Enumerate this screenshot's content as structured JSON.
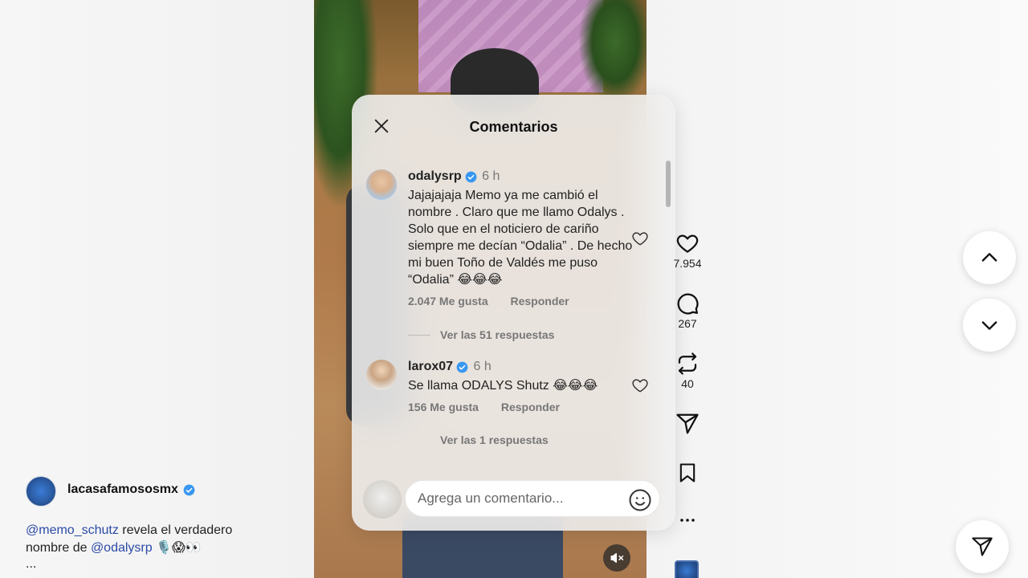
{
  "panel": {
    "title": "Comentarios"
  },
  "comments": [
    {
      "username": "odalysrp",
      "time": "6 h",
      "text": "Jajajajaja Memo ya me cambió el nombre . Claro que me llamo Odalys . Solo que en el noticiero de cariño siempre me decían “Odalia” . De hecho mi buen Toño de Valdés me puso “Odalia” 😂😂😂",
      "likes": "2.047 Me gusta",
      "reply": "Responder",
      "view_replies": "Ver las 51 respuestas"
    },
    {
      "username": "larox07",
      "time": "6 h",
      "text": "Se llama ODALYS Shutz 😂😂😂",
      "likes": "156 Me gusta",
      "reply": "Responder",
      "view_replies": "Ver las 1 respuestas"
    }
  ],
  "composer": {
    "placeholder": "Agrega un comentario..."
  },
  "actions": {
    "likes": "7.954",
    "comments": "267",
    "reposts": "40"
  },
  "post": {
    "author": "lacasafamososmx",
    "mention_1": "@memo_schutz",
    "caption_mid": " revela el verdadero nombre de ",
    "mention_2": "@odalysrp",
    "caption_end": " 🎙️😱👀",
    "more": "..."
  },
  "colors": {
    "verified": "#3897f0",
    "mention": "#2b4aa6"
  }
}
